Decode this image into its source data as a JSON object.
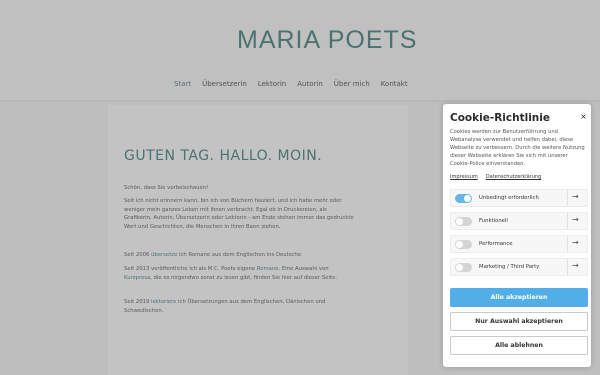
{
  "header": {
    "logo": "MARIA POETS",
    "nav": [
      "Start",
      "Übersetzerin",
      "Lektorin",
      "Autorin",
      "Über mich",
      "Kontakt"
    ]
  },
  "main": {
    "headline": "GUTEN TAG. HALLO. MOIN.",
    "p1": "Schön, dass Sie vorbeischauen!",
    "p2": "Seit ich nicht erinnern kann, bin ich von Büchern fasziert, und ich habe mehr oder weniger mein ganzes Leben mit ihnen verbracht. Egal ob in Druckereien, als Grafikerin, Autorin, Übersetzerin oder Lektorin - am Ende stehen immer das gedruckte Wort und Geschichten, die Menschen in ihren Bann ziehen.",
    "p3_pre": "Seit 2006 ",
    "p3_link": "übersetze",
    "p3_post": " ich Romane aus dem Englischen ins Deutsche.",
    "p4_pre": "Seit 2013 veröffentliche ich als M.C. Poets eigene ",
    "p4_link1": "Romane",
    "p4_mid": ". Eine Auswahl von ",
    "p4_link2": "Kurzprosa",
    "p4_post": ", die es nirgendwo sonst zu lesen gibt, finden Sie hier auf dieser Seite.",
    "p5_pre": "Seit 2019 ",
    "p5_link": "lektoriere",
    "p5_post": " ich Übersetzungen aus dem Englischen, Dänischen und Schwedischen."
  },
  "cookie": {
    "title": "Cookie-Richtlinie",
    "close": "×",
    "text": "Cookies werden zur Benutzerführung und Webanalyse verwendet und helfen dabei, diese Webseite zu verbessern. Durch die weitere Nutzung dieser Webseite erklären Sie sich mit unserer Cookie-Police einverstanden.",
    "links": [
      "Impressum",
      "Datenschutzerklärung"
    ],
    "options": [
      {
        "label": "Unbedingt erforderlich",
        "on": true
      },
      {
        "label": "Funktionell",
        "on": false
      },
      {
        "label": "Performance",
        "on": false
      },
      {
        "label": "Marketing / Third Party",
        "on": false
      }
    ],
    "arrow_icon": "arrow-right-icon",
    "accept_all": "Alle akzeptieren",
    "accept_selection": "Nur Auswahl akzeptieren",
    "reject_all": "Alle ablehnen"
  },
  "colors": {
    "accent": "#2f6e6a",
    "button_primary": "#51aee6",
    "toggle_on": "#69b6e4"
  }
}
